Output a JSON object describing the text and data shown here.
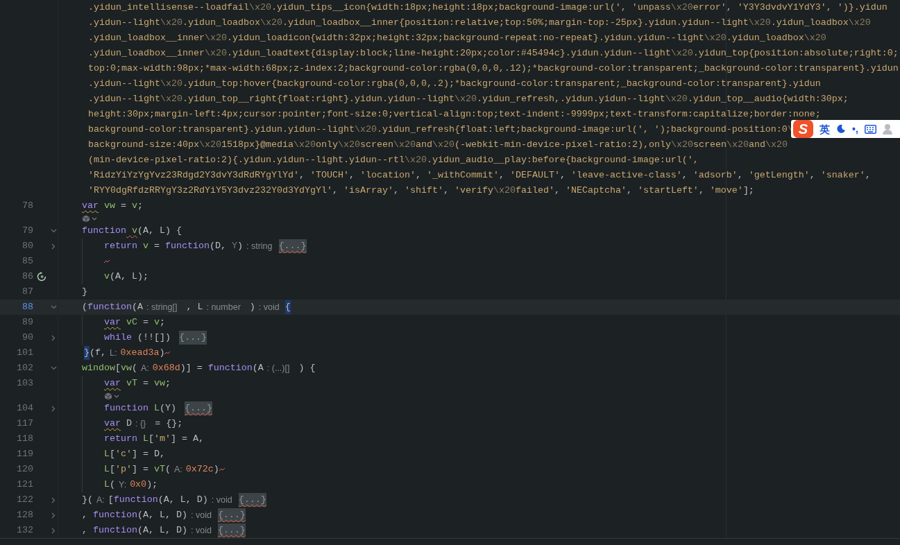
{
  "editor": {
    "lines": [
      {
        "kind": "wrapped",
        "segments": [
          {
            "kind": "str",
            "text": ".yidun_intellisense--loadfail"
          },
          {
            "kind": "esc",
            "text": "\\x20"
          },
          {
            "kind": "str",
            "text": ".yidun_tips__icon{width:18px;height:18px;background-image:url(', 'unpass"
          },
          {
            "kind": "esc",
            "text": "\\x20"
          },
          {
            "kind": "str",
            "text": "error', 'Y3Y3dvdvY1YdY3', ')}.yidun"
          }
        ]
      },
      {
        "kind": "wrapped",
        "segments": [
          {
            "kind": "str",
            "text": ".yidun--light"
          },
          {
            "kind": "esc",
            "text": "\\x20"
          },
          {
            "kind": "str",
            "text": ".yidun_loadbox"
          },
          {
            "kind": "esc",
            "text": "\\x20"
          },
          {
            "kind": "str",
            "text": ".yidun_loadbox__inner{position:relative;top:50%;margin-top:-25px}.yidun.yidun--light"
          },
          {
            "kind": "esc",
            "text": "\\x20"
          },
          {
            "kind": "str",
            "text": ".yidun_loadbox"
          },
          {
            "kind": "esc",
            "text": "\\x20"
          }
        ]
      },
      {
        "kind": "wrapped",
        "segments": [
          {
            "kind": "str",
            "text": ".yidun_loadbox__inner"
          },
          {
            "kind": "esc",
            "text": "\\x20"
          },
          {
            "kind": "str",
            "text": ".yidun_loadicon{width:32px;height:32px;background-repeat:no-repeat}.yidun.yidun--light"
          },
          {
            "kind": "esc",
            "text": "\\x20"
          },
          {
            "kind": "str",
            "text": ".yidun_loadbox"
          },
          {
            "kind": "esc",
            "text": "\\x20"
          }
        ]
      },
      {
        "kind": "wrapped",
        "segments": [
          {
            "kind": "str",
            "text": ".yidun_loadbox__inner"
          },
          {
            "kind": "esc",
            "text": "\\x20"
          },
          {
            "kind": "str",
            "text": ".yidun_loadtext{display:block;line-height:20px;color:#45494c}.yidun.yidun--light"
          },
          {
            "kind": "esc",
            "text": "\\x20"
          },
          {
            "kind": "str",
            "text": ".yidun_top{position:absolute;right:0;"
          }
        ]
      },
      {
        "kind": "wrapped",
        "segments": [
          {
            "kind": "str",
            "text": "top:0;max-width:98px;*max-width:68px;z-index:2;background-color:rgba(0,0,0,.12);*background-color:transparent;_background-color:transparent}.yidun"
          }
        ]
      },
      {
        "kind": "wrapped",
        "segments": [
          {
            "kind": "str",
            "text": ".yidun--light"
          },
          {
            "kind": "esc",
            "text": "\\x20"
          },
          {
            "kind": "str",
            "text": ".yidun_top:hover{background-color:rgba(0,0,0,.2);*background-color:transparent;_background-color:transparent}.yidun"
          }
        ]
      },
      {
        "kind": "wrapped",
        "segments": [
          {
            "kind": "str",
            "text": ".yidun--light"
          },
          {
            "kind": "esc",
            "text": "\\x20"
          },
          {
            "kind": "str",
            "text": ".yidun_top__right{float:right}.yidun.yidun--light"
          },
          {
            "kind": "esc",
            "text": "\\x20"
          },
          {
            "kind": "str",
            "text": ".yidun_refresh,.yidun.yidun--light"
          },
          {
            "kind": "esc",
            "text": "\\x20"
          },
          {
            "kind": "str",
            "text": ".yidun_top__audio{width:30px;"
          }
        ]
      },
      {
        "kind": "wrapped",
        "segments": [
          {
            "kind": "str",
            "text": "height:30px;margin-left:4px;cursor:pointer;font-size:0;vertical-align:top;text-indent:-9999px;text-transform:capitalize;border:none;"
          }
        ]
      },
      {
        "kind": "wrapped",
        "segments": [
          {
            "kind": "str",
            "text": "background-color:transparent}.yidun.yidun--light"
          },
          {
            "kind": "esc",
            "text": "\\x20"
          },
          {
            "kind": "str",
            "text": ".yidun_refresh{float:left;background-image:url(', ');background-position:0"
          },
          {
            "kind": "esc",
            "text": "\\"
          }
        ]
      },
      {
        "kind": "wrapped",
        "segments": [
          {
            "kind": "str",
            "text": "background-size:40px"
          },
          {
            "kind": "esc",
            "text": "\\x20"
          },
          {
            "kind": "str",
            "text": "1518px}@media"
          },
          {
            "kind": "esc",
            "text": "\\x20"
          },
          {
            "kind": "str",
            "text": "only"
          },
          {
            "kind": "esc",
            "text": "\\x20"
          },
          {
            "kind": "str",
            "text": "screen"
          },
          {
            "kind": "esc",
            "text": "\\x20"
          },
          {
            "kind": "str",
            "text": "and"
          },
          {
            "kind": "esc",
            "text": "\\x20"
          },
          {
            "kind": "str",
            "text": "(-webkit-min-device-pixel-ratio:2),only"
          },
          {
            "kind": "esc",
            "text": "\\x20"
          },
          {
            "kind": "str",
            "text": "screen"
          },
          {
            "kind": "esc",
            "text": "\\x20"
          },
          {
            "kind": "str",
            "text": "and"
          },
          {
            "kind": "esc",
            "text": "\\x20"
          }
        ]
      },
      {
        "kind": "wrapped",
        "segments": [
          {
            "kind": "str",
            "text": "(min-device-pixel-ratio:2){.yidun.yidun--light.yidun--rtl"
          },
          {
            "kind": "esc",
            "text": "\\x20"
          },
          {
            "kind": "str",
            "text": ".yidun_audio__play:before{background-image:url(',"
          }
        ]
      },
      {
        "kind": "wrapped",
        "segments": [
          {
            "kind": "str",
            "text": "'RidzYiYzYgYvz23Rdgd2Y3dvY3dRdRYgYlYd'"
          },
          {
            "kind": "plain",
            "text": ", "
          },
          {
            "kind": "str",
            "text": "'TOUCH'"
          },
          {
            "kind": "plain",
            "text": ", "
          },
          {
            "kind": "str",
            "text": "'location'"
          },
          {
            "kind": "plain",
            "text": ", "
          },
          {
            "kind": "str",
            "text": "'_withCommit'"
          },
          {
            "kind": "plain",
            "text": ", "
          },
          {
            "kind": "str",
            "text": "'DEFAULT'"
          },
          {
            "kind": "plain",
            "text": ", "
          },
          {
            "kind": "str",
            "text": "'leave-active-class'"
          },
          {
            "kind": "plain",
            "text": ", "
          },
          {
            "kind": "str",
            "text": "'adsorb'"
          },
          {
            "kind": "plain",
            "text": ", "
          },
          {
            "kind": "str",
            "text": "'getLength'"
          },
          {
            "kind": "plain",
            "text": ", "
          },
          {
            "kind": "str",
            "text": "'snaker'"
          },
          {
            "kind": "plain",
            "text": ","
          }
        ]
      },
      {
        "kind": "wrapped",
        "segments": [
          {
            "kind": "str",
            "text": "'RYY0dgRfdzRRYgY3z2RdYiY5Y3dvz232Y0d3YdYgYl'"
          },
          {
            "kind": "plain",
            "text": ", "
          },
          {
            "kind": "str",
            "text": "'isArray'"
          },
          {
            "kind": "plain",
            "text": ", "
          },
          {
            "kind": "str",
            "text": "'shift'"
          },
          {
            "kind": "plain",
            "text": ", "
          },
          {
            "kind": "str",
            "text": "'verify"
          },
          {
            "kind": "esc",
            "text": "\\x20"
          },
          {
            "kind": "str",
            "text": "failed'"
          },
          {
            "kind": "plain",
            "text": ", "
          },
          {
            "kind": "str",
            "text": "'NECaptcha'"
          },
          {
            "kind": "plain",
            "text": ", "
          },
          {
            "kind": "str",
            "text": "'startLeft'"
          },
          {
            "kind": "plain",
            "text": ", "
          },
          {
            "kind": "str",
            "text": "'move'"
          },
          {
            "kind": "plain",
            "text": "];"
          }
        ]
      },
      {
        "kind": "code",
        "number": "78",
        "current": false,
        "indented": false,
        "segments": [
          {
            "kind": "kw",
            "text": "var",
            "warning": true
          },
          {
            "kind": "ident",
            "text": " vw"
          },
          {
            "kind": "plain",
            "text": " = "
          },
          {
            "kind": "ident",
            "text": "v"
          },
          {
            "kind": "plain",
            "text": ";"
          }
        ]
      },
      {
        "kind": "inlay",
        "indented": false
      },
      {
        "kind": "code",
        "number": "79",
        "fold_open": true,
        "current": false,
        "indented": false,
        "segments": [
          {
            "kind": "kw",
            "text": "function"
          },
          {
            "kind": "ident",
            "text": " v",
            "error": true
          },
          {
            "kind": "plain",
            "text": "(A, L) {"
          }
        ]
      },
      {
        "kind": "code",
        "number": "80",
        "fold_open": false,
        "current": false,
        "indented": true,
        "segments": [
          {
            "kind": "kw",
            "text": "return"
          },
          {
            "kind": "ident",
            "text": " v"
          },
          {
            "kind": "plain",
            "text": " = "
          },
          {
            "kind": "kw",
            "text": "function"
          },
          {
            "kind": "plain",
            "text": "(D, "
          },
          {
            "kind": "unused",
            "text": "Y"
          },
          {
            "kind": "plain",
            "text": ")"
          },
          {
            "kind": "hint",
            "text": ": string"
          },
          {
            "kind": "fold",
            "text": "{...}",
            "error": true
          }
        ]
      },
      {
        "kind": "code",
        "number": "85",
        "current": false,
        "indented": true,
        "segments": [
          {
            "kind": "mark"
          }
        ]
      },
      {
        "kind": "code",
        "number": "86",
        "rerun_marker": true,
        "current": false,
        "indented": true,
        "segments": [
          {
            "kind": "ident",
            "text": "v"
          },
          {
            "kind": "plain",
            "text": "(A, L);"
          }
        ]
      },
      {
        "kind": "code",
        "number": "87",
        "current": false,
        "indented": false,
        "segments": [
          {
            "kind": "plain",
            "text": "}"
          }
        ]
      },
      {
        "kind": "code",
        "number": "88",
        "fold_open": true,
        "current": true,
        "indented": false,
        "segments": [
          {
            "kind": "plain",
            "text": "("
          },
          {
            "kind": "kw",
            "text": "function"
          },
          {
            "kind": "plain",
            "text": "(A"
          },
          {
            "kind": "hint",
            "text": ": string[]"
          },
          {
            "kind": "plain",
            "text": " , L"
          },
          {
            "kind": "hint",
            "text": ": number"
          },
          {
            "kind": "plain",
            "text": " )"
          },
          {
            "kind": "hint",
            "text": ": void"
          },
          {
            "kind": "brace",
            "text": "{"
          }
        ]
      },
      {
        "kind": "code",
        "number": "89",
        "current": false,
        "indented": true,
        "segments": [
          {
            "kind": "kw",
            "text": "var",
            "warning": true
          },
          {
            "kind": "ident",
            "text": " vC"
          },
          {
            "kind": "plain",
            "text": " = "
          },
          {
            "kind": "ident",
            "text": "v"
          },
          {
            "kind": "plain",
            "text": ";"
          }
        ]
      },
      {
        "kind": "code",
        "number": "90",
        "fold_open": false,
        "current": false,
        "indented": true,
        "segments": [
          {
            "kind": "kw",
            "text": "while"
          },
          {
            "kind": "plain",
            "text": " (!![]) "
          },
          {
            "kind": "fold",
            "text": "{...}",
            "error": false
          }
        ]
      },
      {
        "kind": "code",
        "number": "101",
        "current": false,
        "indented": false,
        "segments": [
          {
            "kind": "brace",
            "text": "}"
          },
          {
            "kind": "plain",
            "text": "(f,"
          },
          {
            "kind": "hint",
            "text": "L:"
          },
          {
            "kind": "num",
            "text": "0xead3a"
          },
          {
            "kind": "plain",
            "text": ")"
          },
          {
            "kind": "mark"
          }
        ]
      },
      {
        "kind": "code",
        "number": "102",
        "fold_open": true,
        "current": false,
        "indented": false,
        "segments": [
          {
            "kind": "ident",
            "text": "window"
          },
          {
            "kind": "plain",
            "text": "["
          },
          {
            "kind": "ident",
            "text": "vw"
          },
          {
            "kind": "plain",
            "text": "("
          },
          {
            "kind": "hint",
            "text": "A:"
          },
          {
            "kind": "num",
            "text": "0x68d"
          },
          {
            "kind": "plain",
            "text": ")] = "
          },
          {
            "kind": "kw",
            "text": "function"
          },
          {
            "kind": "plain",
            "text": "(A"
          },
          {
            "kind": "hint",
            "text": ": (...)[]"
          },
          {
            "kind": "plain",
            "text": " ) {"
          }
        ]
      },
      {
        "kind": "code",
        "number": "103",
        "current": false,
        "indented": true,
        "segments": [
          {
            "kind": "kw",
            "text": "var",
            "warning": true
          },
          {
            "kind": "ident",
            "text": " vT"
          },
          {
            "kind": "plain",
            "text": " = "
          },
          {
            "kind": "ident",
            "text": "vw"
          },
          {
            "kind": "plain",
            "text": ";"
          }
        ]
      },
      {
        "kind": "inlay",
        "indented": true
      },
      {
        "kind": "code",
        "number": "104",
        "fold_open": false,
        "current": false,
        "indented": true,
        "segments": [
          {
            "kind": "kw",
            "text": "function"
          },
          {
            "kind": "ident",
            "text": " L"
          },
          {
            "kind": "plain",
            "text": "(Y) "
          },
          {
            "kind": "fold",
            "text": "{...}",
            "error": true
          }
        ]
      },
      {
        "kind": "code",
        "number": "117",
        "current": false,
        "indented": true,
        "segments": [
          {
            "kind": "kw",
            "text": "var",
            "warning": true
          },
          {
            "kind": "plain",
            "text": " D"
          },
          {
            "kind": "hint",
            "text": ": {}"
          },
          {
            "kind": "plain",
            "text": " = {};"
          }
        ]
      },
      {
        "kind": "code",
        "number": "118",
        "current": false,
        "indented": true,
        "segments": [
          {
            "kind": "kw",
            "text": "return"
          },
          {
            "kind": "ident",
            "text": " L"
          },
          {
            "kind": "plain",
            "text": "["
          },
          {
            "kind": "str",
            "text": "'m'"
          },
          {
            "kind": "plain",
            "text": "] = A,"
          }
        ]
      },
      {
        "kind": "code",
        "number": "119",
        "current": false,
        "indented": true,
        "segments": [
          {
            "kind": "ident",
            "text": "L"
          },
          {
            "kind": "plain",
            "text": "["
          },
          {
            "kind": "str",
            "text": "'c'"
          },
          {
            "kind": "plain",
            "text": "] = D,"
          }
        ]
      },
      {
        "kind": "code",
        "number": "120",
        "current": false,
        "indented": true,
        "segments": [
          {
            "kind": "ident",
            "text": "L"
          },
          {
            "kind": "plain",
            "text": "["
          },
          {
            "kind": "str",
            "text": "'p'"
          },
          {
            "kind": "plain",
            "text": "] = "
          },
          {
            "kind": "ident",
            "text": "vT"
          },
          {
            "kind": "plain",
            "text": "("
          },
          {
            "kind": "hint",
            "text": "A:"
          },
          {
            "kind": "num",
            "text": "0x72c"
          },
          {
            "kind": "plain",
            "text": ")"
          },
          {
            "kind": "mark"
          }
        ]
      },
      {
        "kind": "code",
        "number": "121",
        "current": false,
        "indented": true,
        "segments": [
          {
            "kind": "ident",
            "text": "L"
          },
          {
            "kind": "plain",
            "text": "("
          },
          {
            "kind": "hint",
            "text": "Y:"
          },
          {
            "kind": "num",
            "text": "0x0"
          },
          {
            "kind": "plain",
            "text": ");"
          }
        ]
      },
      {
        "kind": "code",
        "number": "122",
        "fold_open": false,
        "current": false,
        "indented": false,
        "segments": [
          {
            "kind": "plain",
            "text": "}("
          },
          {
            "kind": "hint",
            "text": "A:"
          },
          {
            "kind": "plain",
            "text": "["
          },
          {
            "kind": "kw",
            "text": "function"
          },
          {
            "kind": "plain",
            "text": "(A, L, D)"
          },
          {
            "kind": "hint",
            "text": ": void"
          },
          {
            "kind": "fold",
            "text": "{...}",
            "error": true
          }
        ]
      },
      {
        "kind": "code",
        "number": "128",
        "fold_open": false,
        "current": false,
        "indented": false,
        "segments": [
          {
            "kind": "plain",
            "text": ", "
          },
          {
            "kind": "kw",
            "text": "function"
          },
          {
            "kind": "plain",
            "text": "(A, L, D)"
          },
          {
            "kind": "hint",
            "text": ": void"
          },
          {
            "kind": "fold",
            "text": "{...}",
            "error": true
          }
        ]
      },
      {
        "kind": "code",
        "number": "132",
        "fold_open": false,
        "current": false,
        "indented": false,
        "segments": [
          {
            "kind": "plain",
            "text": ", "
          },
          {
            "kind": "kw",
            "text": "function"
          },
          {
            "kind": "plain",
            "text": "(A, L, D)"
          },
          {
            "kind": "hint",
            "text": ": void"
          },
          {
            "kind": "fold",
            "text": "{...}",
            "error": true
          }
        ]
      }
    ]
  },
  "ime_toolbar": {
    "logo": "S",
    "language": "英",
    "punctuation": "•,"
  }
}
